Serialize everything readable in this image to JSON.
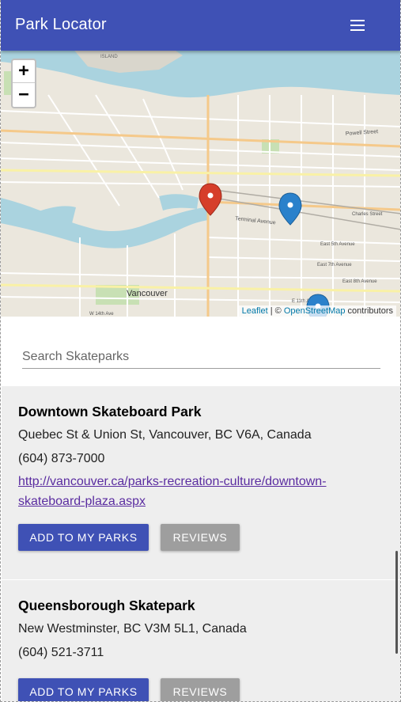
{
  "appbar": {
    "title": "Park Locator",
    "menu_icon": "menu-icon"
  },
  "map": {
    "zoom_in": "+",
    "zoom_out": "−",
    "labels": {
      "vancouver": "Vancouver",
      "powell": "Powell Street",
      "terminal": "Terminal Avenue",
      "charles": "Charles Street",
      "seventh": "East 7th Avenue",
      "eighth": "East 8th Avenue",
      "e11": "E 11th Avenue",
      "w14": "W 14th Ave",
      "east5": "East 5th Avenue",
      "island": "ISLAND"
    },
    "attribution": {
      "leaflet": "Leaflet",
      "sep": " | © ",
      "osm": "OpenStreetMap",
      "suffix": " contributors"
    },
    "marker_colors": {
      "red": "#d63e2a",
      "blue": "#2a81cb"
    }
  },
  "search": {
    "placeholder": "Search Skateparks"
  },
  "parks": [
    {
      "name": "Downtown Skateboard Park",
      "address": "Quebec St & Union St, Vancouver, BC V6A, Canada",
      "phone": "(604) 873-7000",
      "url": "http://vancouver.ca/parks-recreation-culture/downtown-skateboard-plaza.aspx",
      "add_label": "ADD TO MY PARKS",
      "reviews_label": "REVIEWS"
    },
    {
      "name": "Queensborough Skatepark",
      "address": "New Westminster, BC V3M 5L1, Canada",
      "phone": "(604) 521-3711",
      "add_label": "ADD TO MY PARKS",
      "reviews_label": "REVIEWS"
    }
  ]
}
